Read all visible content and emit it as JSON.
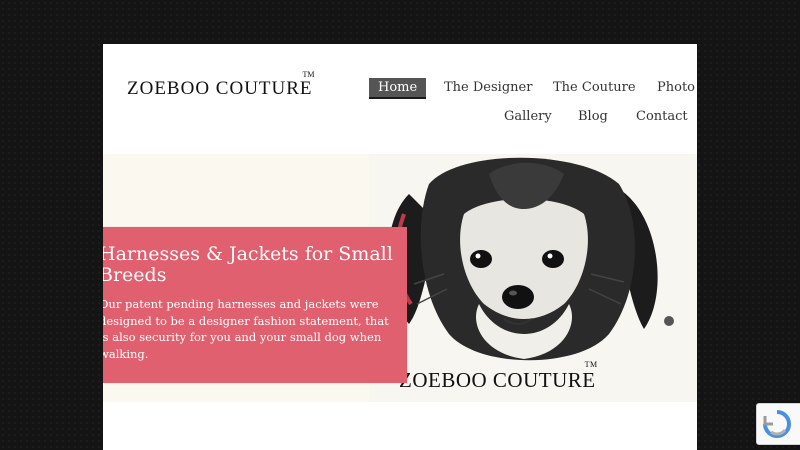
{
  "header": {
    "logo_text": "ZOEBOO COUTURE",
    "logo_tm": "TM"
  },
  "nav": {
    "items": [
      {
        "label": "Home",
        "active": true
      },
      {
        "label": "The Designer"
      },
      {
        "label": "The Couture"
      },
      {
        "label": "Photo"
      },
      {
        "label": "Gallery"
      },
      {
        "label": "Blog"
      },
      {
        "label": "Contact"
      }
    ]
  },
  "hero": {
    "title": "Harnesses & Jackets for Small Breeds",
    "text": "Our patent pending harnesses and jackets were designed to be a designer fashion statement, that is also security for you and your small dog when walking.",
    "image_brand": "ZOEBOO COUTURE",
    "image_brand_tm": "TM",
    "caption_color": "#e0606f"
  },
  "colors": {
    "background": "#141414",
    "page": "#ffffff",
    "nav_active": "#555555"
  }
}
